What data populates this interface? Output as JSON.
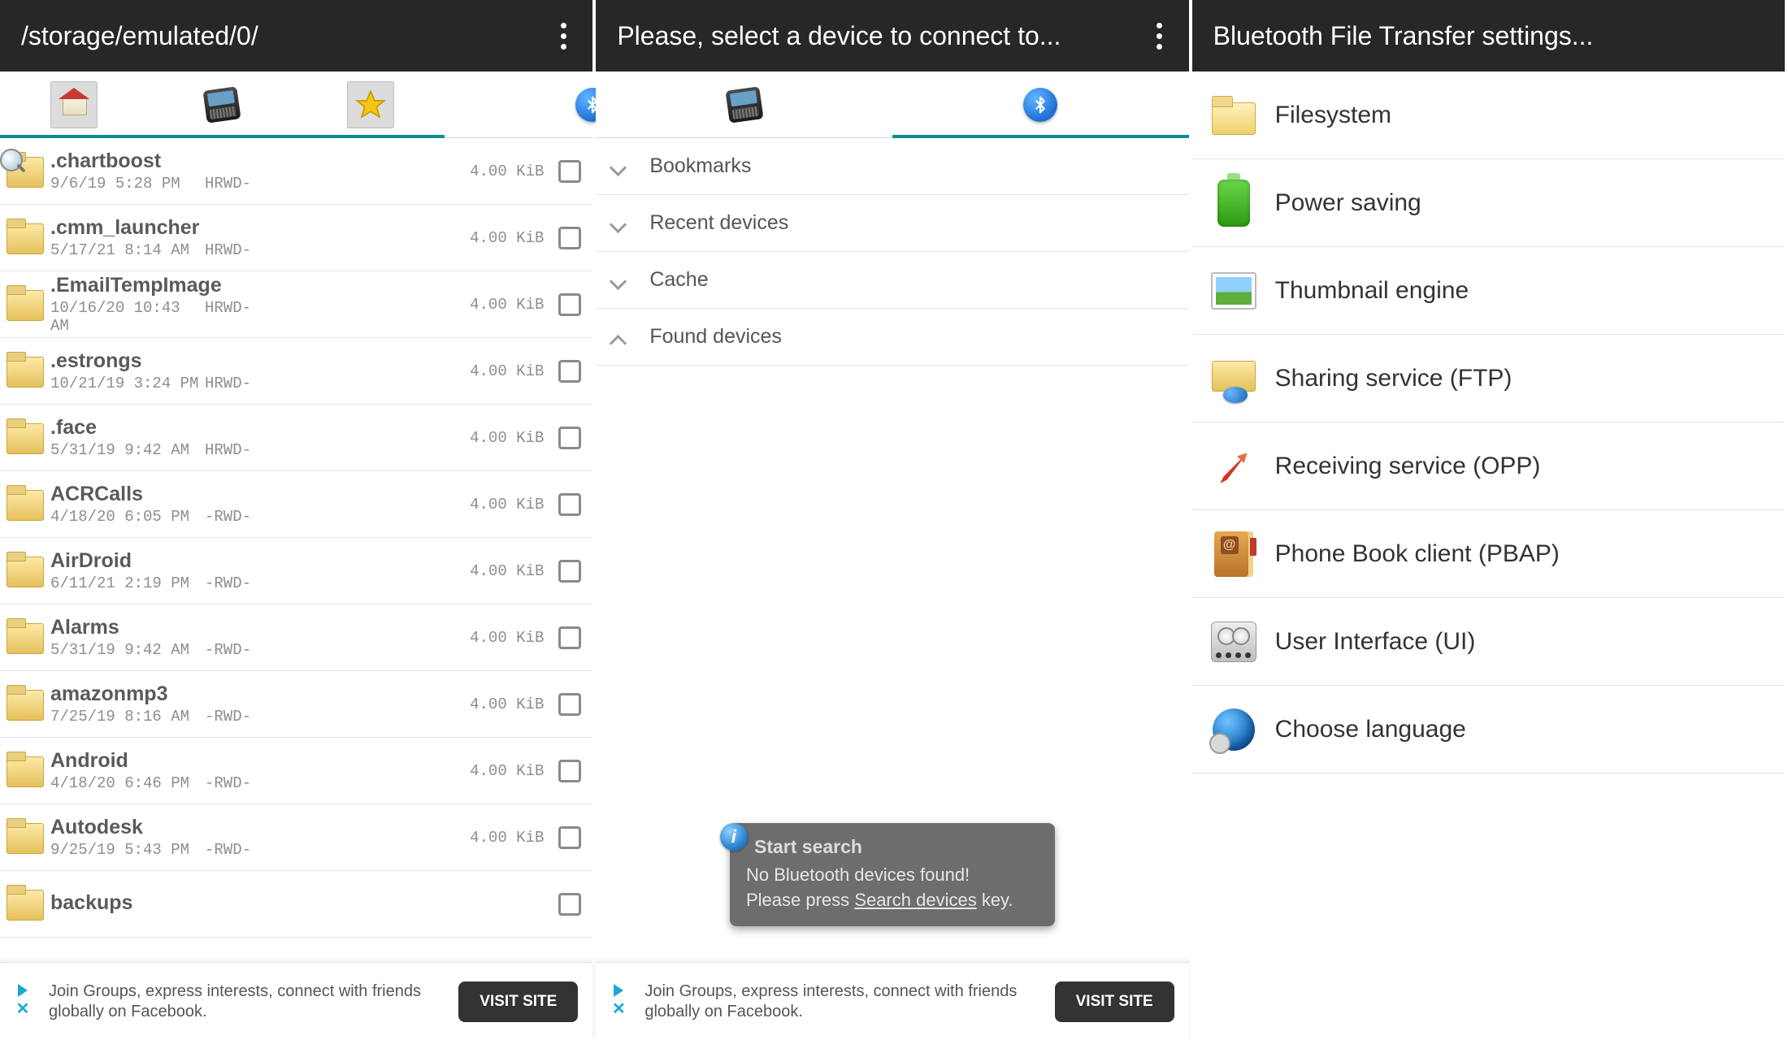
{
  "panel1": {
    "title": "/storage/emulated/0/",
    "tabs": [
      "home",
      "device",
      "star",
      "bluetooth"
    ],
    "files": [
      {
        "name": ".chartboost",
        "date": "9/6/19 5:28 PM",
        "perm": "HRWD-",
        "size": "4.00 KiB",
        "magnify": true
      },
      {
        "name": ".cmm_launcher",
        "date": "5/17/21 8:14 AM",
        "perm": "HRWD-",
        "size": "4.00 KiB"
      },
      {
        "name": ".EmailTempImage",
        "date": "10/16/20 10:43 AM",
        "perm": "HRWD-",
        "size": "4.00 KiB"
      },
      {
        "name": ".estrongs",
        "date": "10/21/19 3:24 PM",
        "perm": "HRWD-",
        "size": "4.00 KiB"
      },
      {
        "name": ".face",
        "date": "5/31/19 9:42 AM",
        "perm": "HRWD-",
        "size": "4.00 KiB"
      },
      {
        "name": "ACRCalls",
        "date": "4/18/20 6:05 PM",
        "perm": "-RWD-",
        "size": "4.00 KiB"
      },
      {
        "name": "AirDroid",
        "date": "6/11/21 2:19 PM",
        "perm": "-RWD-",
        "size": "4.00 KiB"
      },
      {
        "name": "Alarms",
        "date": "5/31/19 9:42 AM",
        "perm": "-RWD-",
        "size": "4.00 KiB"
      },
      {
        "name": "amazonmp3",
        "date": "7/25/19 8:16 AM",
        "perm": "-RWD-",
        "size": "4.00 KiB"
      },
      {
        "name": "Android",
        "date": "4/18/20 6:46 PM",
        "perm": "-RWD-",
        "size": "4.00 KiB"
      },
      {
        "name": "Autodesk",
        "date": "9/25/19 5:43 PM",
        "perm": "-RWD-",
        "size": "4.00 KiB"
      },
      {
        "name": "backups",
        "date": "",
        "perm": "",
        "size": ""
      }
    ]
  },
  "panel2": {
    "title": "Please, select a device to connect to...",
    "sections": [
      {
        "label": "Bookmarks",
        "expanded": false
      },
      {
        "label": "Recent devices",
        "expanded": false
      },
      {
        "label": "Cache",
        "expanded": false
      },
      {
        "label": "Found devices",
        "expanded": true
      }
    ],
    "toast": {
      "head": "Start search",
      "line1": "No Bluetooth devices found!",
      "line2a": "Please press ",
      "line2b": "Search devices",
      "line2c": " key."
    }
  },
  "panel3": {
    "title": "Bluetooth File Transfer settings...",
    "items": [
      {
        "icon": "folder",
        "label": "Filesystem"
      },
      {
        "icon": "battery",
        "label": "Power saving"
      },
      {
        "icon": "thumb",
        "label": "Thumbnail engine"
      },
      {
        "icon": "share",
        "label": "Sharing service (FTP)"
      },
      {
        "icon": "arrow",
        "label": "Receiving service (OPP)"
      },
      {
        "icon": "book",
        "label": "Phone Book client (PBAP)"
      },
      {
        "icon": "gauge",
        "label": "User Interface (UI)"
      },
      {
        "icon": "globe",
        "label": "Choose language"
      }
    ]
  },
  "ad": {
    "text": "Join Groups, express interests, connect with friends globally on Facebook.",
    "button": "VISIT SITE"
  }
}
